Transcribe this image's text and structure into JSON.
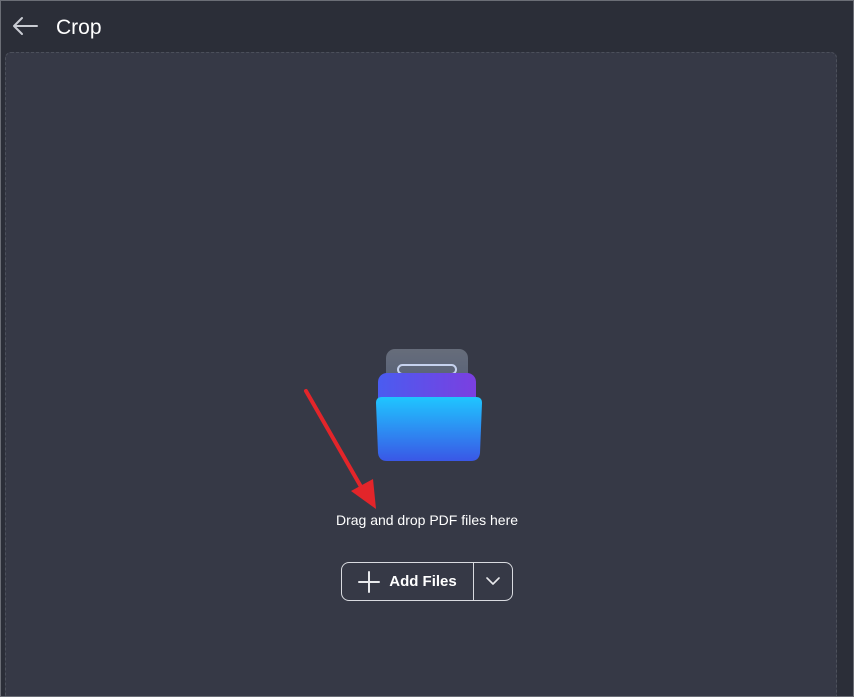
{
  "header": {
    "title": "Crop",
    "back_icon": "arrow-left-icon"
  },
  "dropzone": {
    "illustration_icon": "folder-with-documents-icon",
    "instruction": "Drag and drop PDF files here",
    "add_button_label": "Add Files",
    "add_icon": "plus-icon",
    "dropdown_icon": "chevron-down-icon"
  },
  "colors": {
    "window_bg": "#2b2e38",
    "dropzone_bg": "#363946",
    "annotation_arrow": "#e3252a",
    "folder_gradient_top": "#1fc6ff",
    "folder_gradient_bottom": "#3a57e6"
  }
}
